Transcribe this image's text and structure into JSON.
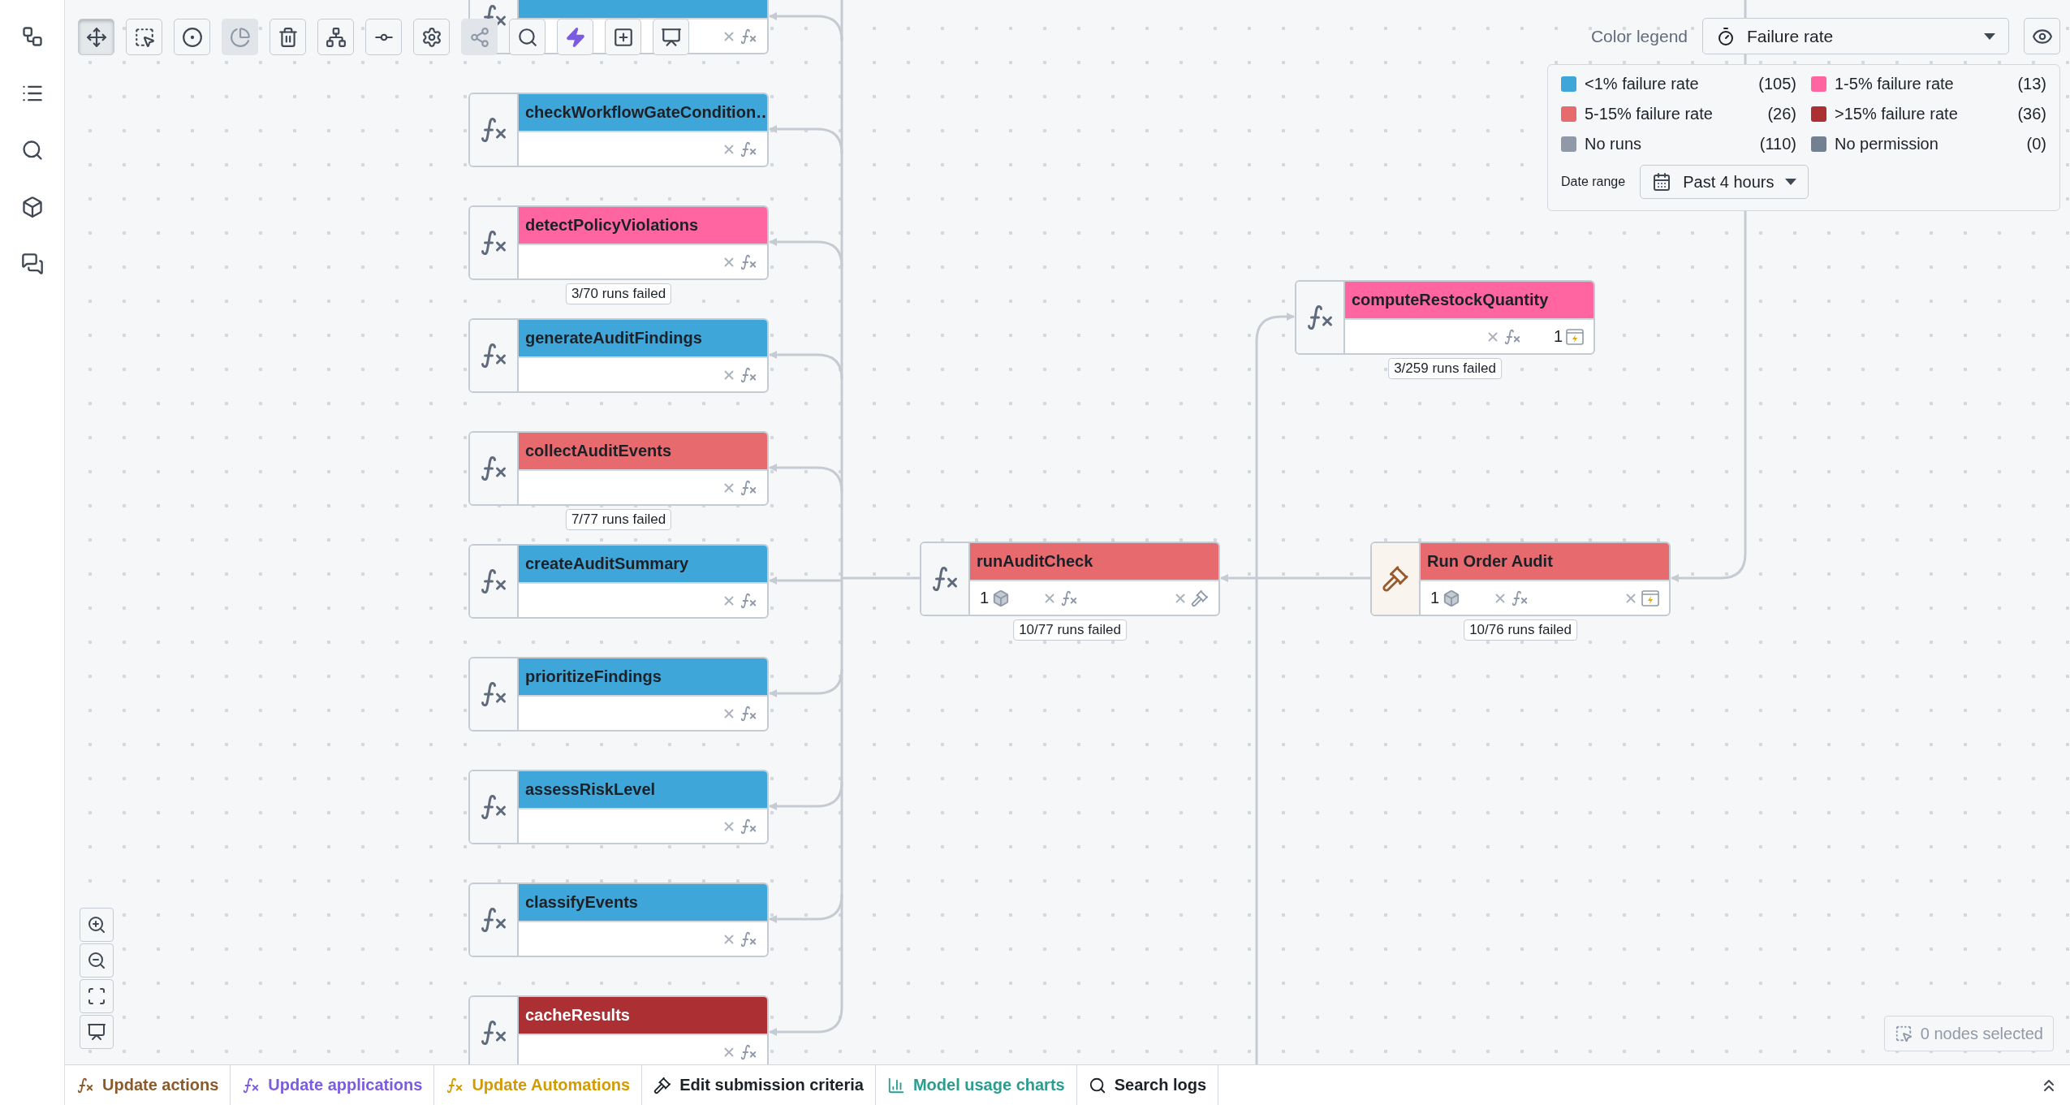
{
  "sidebar": {
    "items": [
      {
        "kind": "graph",
        "selected": false
      },
      {
        "kind": "list",
        "selected": false
      },
      {
        "kind": "search",
        "selected": false
      },
      {
        "kind": "cube",
        "selected": false
      },
      {
        "kind": "chat",
        "selected": false
      }
    ]
  },
  "toolbar": [
    {
      "kind": "pan",
      "selected": true,
      "disabled": false
    },
    {
      "kind": "select",
      "selected": false,
      "disabled": false
    },
    {
      "kind": "center",
      "selected": false,
      "disabled": false
    },
    {
      "kind": "clear",
      "selected": false,
      "disabled": true
    },
    {
      "kind": "trash",
      "selected": false,
      "disabled": false
    },
    {
      "kind": "layout",
      "selected": false,
      "disabled": false
    },
    {
      "kind": "flow",
      "selected": false,
      "disabled": false
    },
    {
      "kind": "settings",
      "selected": false,
      "disabled": false
    },
    {
      "kind": "graph",
      "selected": false,
      "disabled": true
    },
    {
      "kind": "search",
      "selected": false,
      "disabled": false
    },
    {
      "kind": "bolt",
      "selected": false,
      "disabled": false
    },
    {
      "kind": "add",
      "selected": false,
      "disabled": false
    },
    {
      "kind": "present",
      "selected": false,
      "disabled": false
    }
  ],
  "color_legend": {
    "label": "Color legend",
    "metric": "Failure rate",
    "items": [
      {
        "label": "<1% failure rate",
        "count": "(105)",
        "color": "#3fa6da"
      },
      {
        "label": "1-5% failure rate",
        "count": "(13)",
        "color": "#ff66a1"
      },
      {
        "label": "5-15% failure rate",
        "count": "(26)",
        "color": "#e76a6e"
      },
      {
        "label": ">15% failure rate",
        "count": "(36)",
        "color": "#ac2f33"
      },
      {
        "label": "No runs",
        "count": "(110)",
        "color": "#8f99a8"
      },
      {
        "label": "No permission",
        "count": "(0)",
        "color": "#738091"
      }
    ],
    "date_range": {
      "label": "Date range",
      "value": "Past 4 hours"
    }
  },
  "nodes": [
    {
      "kind": "function",
      "color": "#3fa6da",
      "footer": [
        {
          "kind": "no-functions"
        }
      ]
    },
    {
      "kind": "function",
      "name": "checkWorkflowGateCondition…",
      "color": "#3fa6da",
      "footer": [
        {
          "kind": "no-functions"
        }
      ]
    },
    {
      "kind": "function",
      "name": "detectPolicyViolations",
      "color": "#ff66a1",
      "runs_failed": "3/70 runs failed",
      "footer": [
        {
          "kind": "no-functions"
        }
      ]
    },
    {
      "kind": "function",
      "name": "generateAuditFindings",
      "color": "#3fa6da",
      "footer": [
        {
          "kind": "no-functions"
        }
      ]
    },
    {
      "kind": "function",
      "name": "collectAuditEvents",
      "color": "#e76a6e",
      "runs_failed": "7/77 runs failed",
      "footer": [
        {
          "kind": "no-functions"
        }
      ]
    },
    {
      "kind": "function",
      "name": "createAuditSummary",
      "color": "#3fa6da",
      "footer": [
        {
          "kind": "no-functions"
        }
      ]
    },
    {
      "kind": "function",
      "name": "prioritizeFindings",
      "color": "#3fa6da",
      "footer": [
        {
          "kind": "no-functions"
        }
      ]
    },
    {
      "kind": "function",
      "name": "assessRiskLevel",
      "color": "#3fa6da",
      "footer": [
        {
          "kind": "no-functions"
        }
      ]
    },
    {
      "kind": "function",
      "name": "classifyEvents",
      "color": "#3fa6da",
      "footer": [
        {
          "kind": "no-functions"
        }
      ]
    },
    {
      "kind": "function",
      "name": "cacheResults",
      "color": "#ac2f33",
      "footer": [
        {
          "kind": "no-functions"
        }
      ]
    },
    {
      "kind": "function",
      "name": "computeRestockQuantity",
      "color": "#ff66a1",
      "runs_failed": "3/259 runs failed",
      "footer": [
        {
          "kind": "no-functions"
        },
        {
          "kind": "automations",
          "count": "1"
        }
      ]
    },
    {
      "kind": "function",
      "name": "runAuditCheck",
      "color": "#e76a6e",
      "runs_failed": "10/77 runs failed",
      "footer": [
        {
          "kind": "objects",
          "count": "1"
        },
        {
          "kind": "no-functions"
        },
        {
          "kind": "no-actions"
        }
      ]
    },
    {
      "kind": "action",
      "name": "Run Order Audit",
      "color": "#e76a6e",
      "runs_failed": "10/76 runs failed",
      "footer": [
        {
          "kind": "objects",
          "count": "1"
        },
        {
          "kind": "no-functions"
        },
        {
          "kind": "no-automations"
        }
      ]
    }
  ],
  "nodes_selected": "0 nodes selected",
  "bottom_bar": {
    "tabs": [
      {
        "kind": "actions",
        "label": "Update actions"
      },
      {
        "kind": "applications",
        "label": "Update applications"
      },
      {
        "kind": "automations",
        "label": "Update Automations"
      },
      {
        "kind": "criteria",
        "label": "Edit submission criteria"
      },
      {
        "kind": "charts",
        "label": "Model usage charts"
      },
      {
        "kind": "logs",
        "label": "Search logs"
      }
    ]
  }
}
